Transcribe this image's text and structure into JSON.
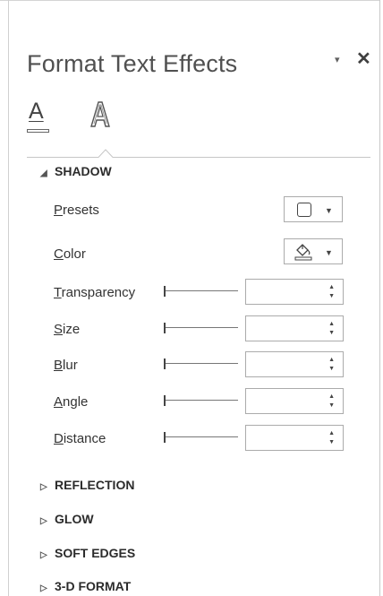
{
  "pane": {
    "title": "Format Text Effects",
    "menu_icon": "▾",
    "close_icon": "✕"
  },
  "tabs": {
    "text_fill_glyph": "A",
    "text_fill_icon": "text-fill-outline-icon",
    "text_effects_icon": "text-effects-icon"
  },
  "shadow": {
    "label": "SHADOW",
    "expanded": true,
    "presets": {
      "accel": "P",
      "rest": "resets"
    },
    "color": {
      "accel": "C",
      "rest": "olor"
    },
    "transparency": {
      "accel": "T",
      "rest": "ransparency",
      "value": ""
    },
    "size": {
      "accel": "S",
      "rest": "ize",
      "value": ""
    },
    "blur": {
      "accel": "B",
      "rest": "lur",
      "value": ""
    },
    "angle": {
      "accel": "A",
      "rest": "ngle",
      "value": ""
    },
    "distance": {
      "accel": "D",
      "rest": "istance",
      "value": ""
    }
  },
  "sections": {
    "reflection": "REFLECTION",
    "glow": "GLOW",
    "soft_edges": "SOFT EDGES",
    "three_d_format": "3-D FORMAT"
  },
  "glyphs": {
    "expanded_arrow": "◢",
    "collapsed_arrow": "▷",
    "dropdown_caret": "▼",
    "spin_up": "▲",
    "spin_down": "▼"
  }
}
